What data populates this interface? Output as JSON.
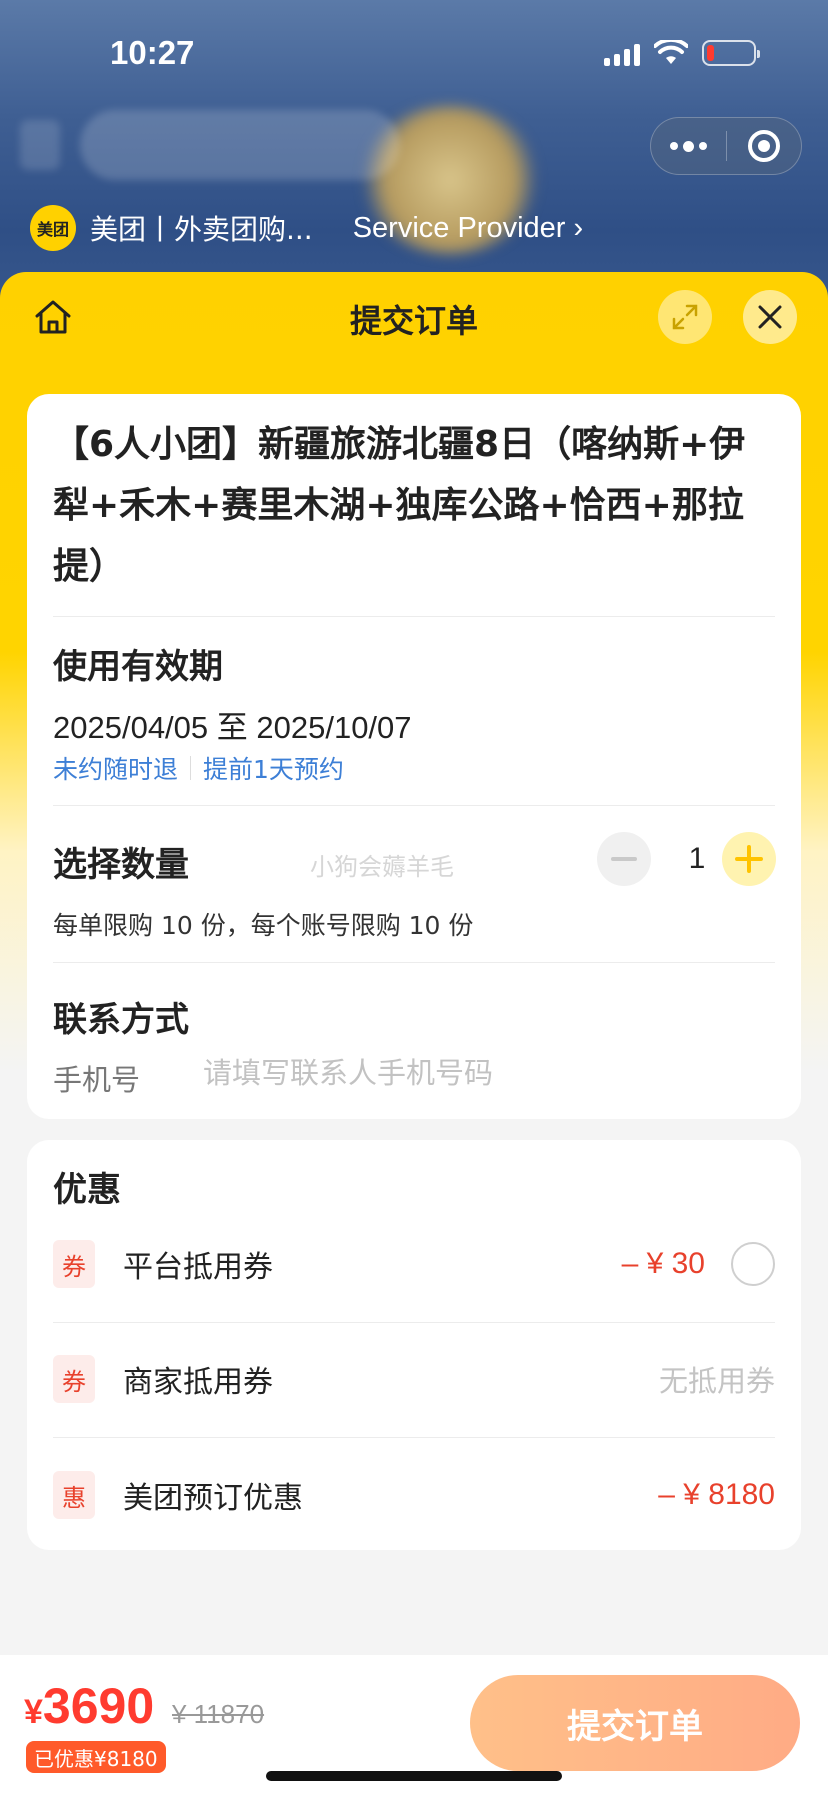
{
  "status_bar": {
    "time": "10:27"
  },
  "provider": {
    "logo_text": "美团",
    "name": "美团丨外卖团购...",
    "service_link": "Service Provider ›"
  },
  "header": {
    "title": "提交订单"
  },
  "product": {
    "title": "【6人小团】新疆旅游北疆8日（喀纳斯+伊犁+禾木+赛里木湖+独库公路+恰西+那拉提）",
    "validity_label": "使用有效期",
    "validity_dates": "2025/04/05 至 2025/10/07",
    "tags": [
      "未约随时退",
      "提前1天预约"
    ]
  },
  "quantity": {
    "label": "选择数量",
    "value": "1",
    "limit_text": "每单限购 10 份，每个账号限购 10 份",
    "watermark": "小狗会薅羊毛"
  },
  "contact": {
    "label": "联系方式",
    "phone_label": "手机号",
    "phone_placeholder": "请填写联系人手机号码",
    "phone_value": ""
  },
  "discounts": {
    "title": "优惠",
    "items": [
      {
        "badge": "券",
        "name": "平台抵用券",
        "amount": "– ¥ 30"
      },
      {
        "badge": "券",
        "name": "商家抵用券",
        "amount": "无抵用券"
      },
      {
        "badge": "惠",
        "name": "美团预订优惠",
        "amount": "– ¥ 8180"
      }
    ]
  },
  "footer": {
    "currency": "¥",
    "price": "3690",
    "original_price": "¥ 11870",
    "saved": "已优惠¥8180",
    "submit_label": "提交订单"
  },
  "colors": {
    "brand_yellow": "#ffd100",
    "discount_red": "#e8412c",
    "link_blue": "#3d7fd6",
    "submit_gradient_start": "#ffc089",
    "submit_gradient_end": "#ffab85"
  }
}
